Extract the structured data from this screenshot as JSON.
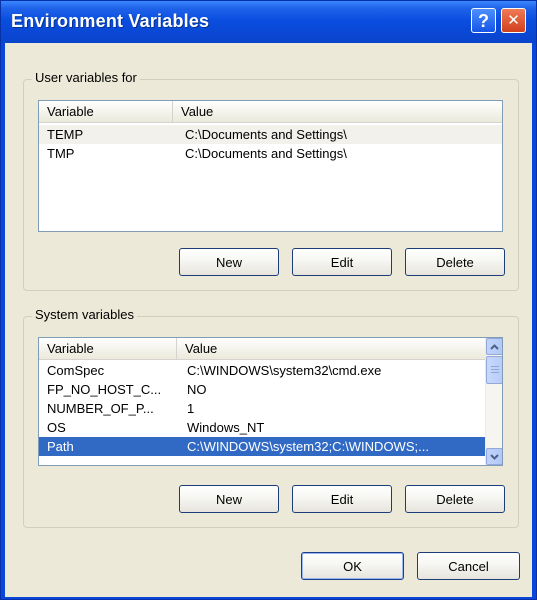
{
  "window": {
    "title": "Environment Variables",
    "help_glyph": "?",
    "close_glyph": "✕"
  },
  "user_vars": {
    "label": "User variables for",
    "columns": [
      "Variable",
      "Value"
    ],
    "rows": [
      {
        "variable": "TEMP",
        "value": "C:\\Documents and Settings\\"
      },
      {
        "variable": "TMP",
        "value": "C:\\Documents and Settings\\"
      }
    ],
    "buttons": {
      "new": "New",
      "edit": "Edit",
      "delete": "Delete"
    }
  },
  "system_vars": {
    "label": "System variables",
    "columns": [
      "Variable",
      "Value"
    ],
    "rows": [
      {
        "variable": "ComSpec",
        "value": "C:\\WINDOWS\\system32\\cmd.exe"
      },
      {
        "variable": "FP_NO_HOST_C...",
        "value": "NO"
      },
      {
        "variable": "NUMBER_OF_P...",
        "value": "1"
      },
      {
        "variable": "OS",
        "value": "Windows_NT"
      },
      {
        "variable": "Path",
        "value": "C:\\WINDOWS\\system32;C:\\WINDOWS;..."
      }
    ],
    "selected_row": 4,
    "buttons": {
      "new": "New",
      "edit": "Edit",
      "delete": "Delete"
    }
  },
  "footer": {
    "ok": "OK",
    "cancel": "Cancel"
  },
  "colors": {
    "title_bar": "#0a4ee0",
    "dialog_bg": "#ece9d8",
    "selection": "#316ac5"
  },
  "icons": {
    "help": "help-icon",
    "close": "close-icon",
    "scroll_up": "chevron-up-icon",
    "scroll_down": "chevron-down-icon"
  }
}
